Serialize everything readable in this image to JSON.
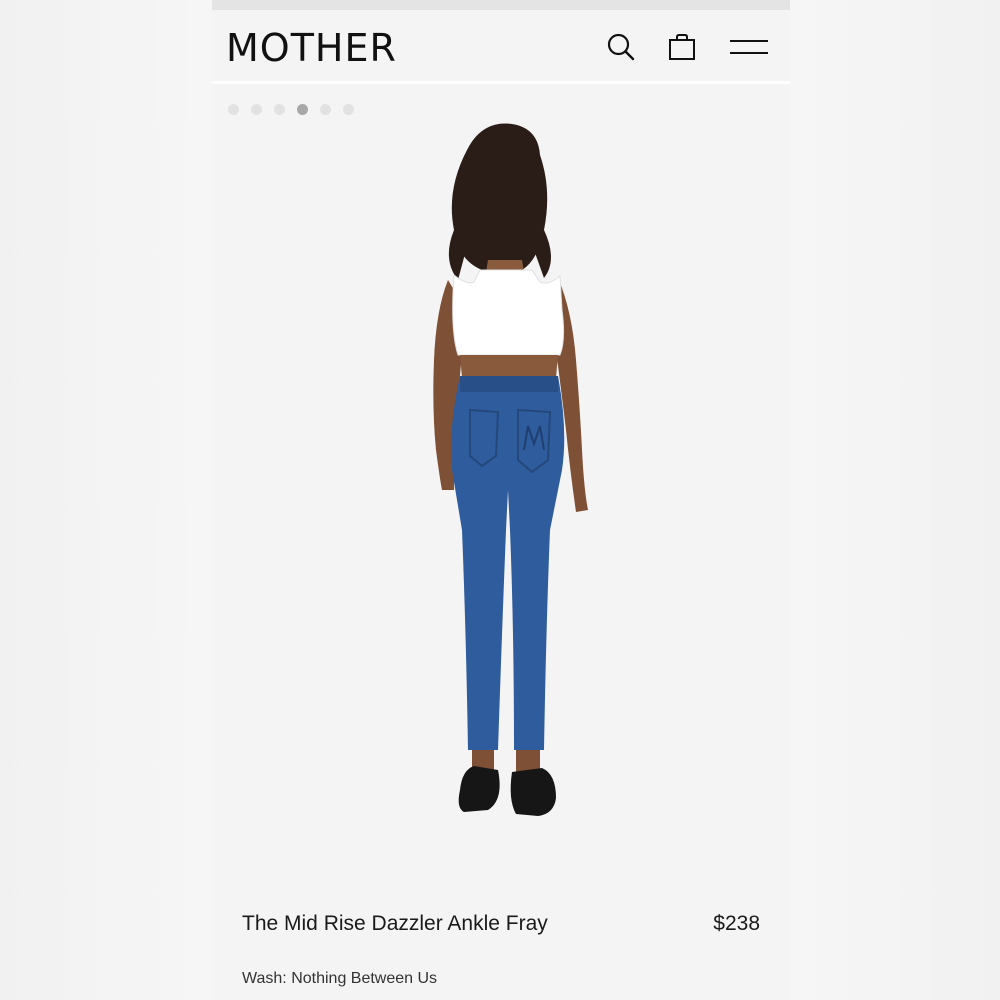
{
  "brand": {
    "logo_text": "MOTHER"
  },
  "header": {
    "icons": [
      "search-icon",
      "bag-icon",
      "menu-icon"
    ]
  },
  "gallery": {
    "dot_count": 6,
    "active_index": 3,
    "image_subject": "model-back-view-jeans"
  },
  "product": {
    "title": "The Mid Rise Dazzler Ankle Fray",
    "price": "$238",
    "wash_label": "Wash: Nothing Between Us"
  },
  "colors": {
    "background": "#f4f4f4",
    "text": "#111111",
    "denim": "#2f5c9c",
    "top": "#ffffff"
  }
}
